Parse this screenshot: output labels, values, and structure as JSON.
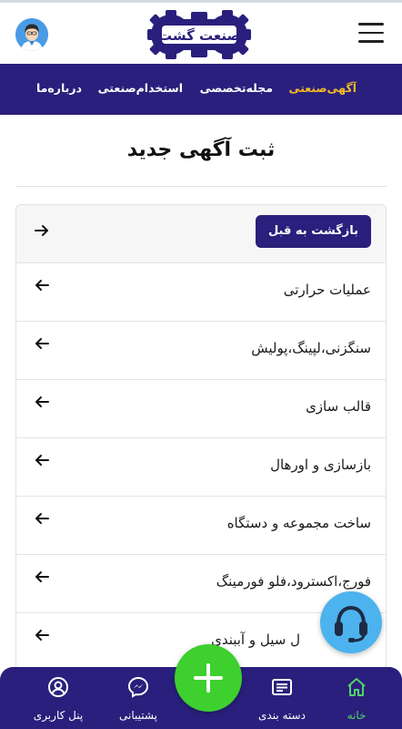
{
  "header": {
    "logo_text": "صنعت گشت",
    "avatar_icon": "user-avatar-icon",
    "menu_icon": "hamburger-menu-icon"
  },
  "nav": {
    "items": [
      {
        "label": "آگهی‌صنعتی",
        "active": true
      },
      {
        "label": "مجله‌تخصصی",
        "active": false
      },
      {
        "label": "استخدام‌صنعتی",
        "active": false
      },
      {
        "label": "درباره‌ما",
        "active": false
      }
    ]
  },
  "page": {
    "title": "ثبت آگهی جدید",
    "back_button": "بازگشت به قبل"
  },
  "categories": [
    "عملیات حرارتی",
    "سنگزنی،لپینگ،پولیش",
    "قالب سازی",
    "بازسازی و اورهال",
    "ساخت مجموعه و دستگاه",
    "فورج،اکسترود،فلو فورمینگ",
    "ل سیل و آببندی"
  ],
  "bottom_nav": {
    "tabs": [
      {
        "label": "خانه",
        "icon": "home-icon",
        "active": true
      },
      {
        "label": "دسته بندی",
        "icon": "category-list-icon",
        "active": false
      },
      {
        "label": "پشتیبانی",
        "icon": "messenger-icon",
        "active": false
      },
      {
        "label": "پنل کاربری",
        "icon": "user-circle-icon",
        "active": false
      }
    ],
    "add_icon": "plus-icon"
  },
  "colors": {
    "primary": "#2a1f7c",
    "accent": "#f4b928",
    "active_tab": "#4fd46a",
    "add_button": "#3dd02e",
    "support_button": "#4cb3ee"
  }
}
